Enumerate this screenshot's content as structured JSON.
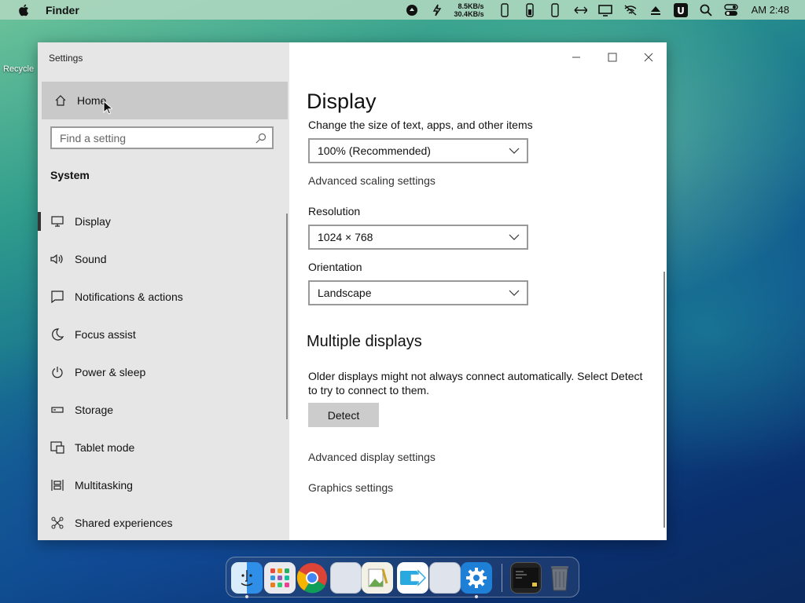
{
  "menubar": {
    "app_name": "Finder",
    "net_up": "8.5KB/s",
    "net_down": "30.4KB/s",
    "clock": "AM 2:48",
    "status_icons": [
      "app-icon",
      "lightning-icon",
      "phone-icon",
      "battery-icon",
      "phone-icon",
      "battery-icon",
      "phone-icon",
      "network-icon",
      "display-icon",
      "no-wifi-icon",
      "eject-icon",
      "u-icon",
      "search-icon",
      "control-center-icon"
    ]
  },
  "desktop": {
    "recycle_label": "Recycle"
  },
  "window": {
    "title": "Settings",
    "home_label": "Home",
    "search_placeholder": "Find a setting",
    "section_label": "System",
    "nav": [
      {
        "label": "Display",
        "icon": "monitor-icon"
      },
      {
        "label": "Sound",
        "icon": "speaker-icon"
      },
      {
        "label": "Notifications & actions",
        "icon": "notification-icon"
      },
      {
        "label": "Focus assist",
        "icon": "moon-icon"
      },
      {
        "label": "Power & sleep",
        "icon": "power-icon"
      },
      {
        "label": "Storage",
        "icon": "storage-icon"
      },
      {
        "label": "Tablet mode",
        "icon": "tablet-icon"
      },
      {
        "label": "Multitasking",
        "icon": "multitasking-icon"
      },
      {
        "label": "Shared experiences",
        "icon": "shared-icon"
      }
    ],
    "active_nav": "Display"
  },
  "content": {
    "title": "Display",
    "scale_label": "Change the size of text, apps, and other items",
    "scale_value": "100% (Recommended)",
    "advanced_scaling_link": "Advanced scaling settings",
    "resolution_label": "Resolution",
    "resolution_value": "1024 × 768",
    "orientation_label": "Orientation",
    "orientation_value": "Landscape",
    "multiple_heading": "Multiple displays",
    "multiple_text": "Older displays might not always connect automatically. Select Detect to try to connect to them.",
    "detect_label": "Detect",
    "advanced_display_link": "Advanced display settings",
    "graphics_link": "Graphics settings"
  },
  "dock": {
    "items": [
      "finder-icon",
      "launchpad-icon",
      "chrome-icon",
      "blank-app-icon",
      "text-editor-icon",
      "migration-icon",
      "blank-app-icon",
      "settings-icon",
      "terminal-icon",
      "trash-icon"
    ]
  }
}
